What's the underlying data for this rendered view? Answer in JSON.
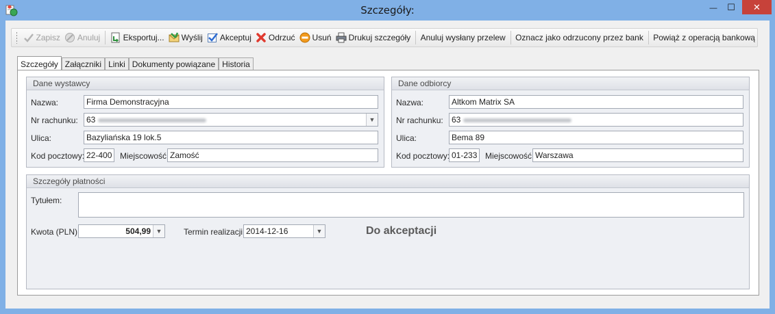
{
  "window": {
    "title": "Szczegóły:",
    "minimize": "—",
    "maximize": "☐",
    "close": "✕"
  },
  "toolbar": {
    "save": "Zapisz",
    "cancel": "Anuluj",
    "export": "Eksportuj...",
    "send": "Wyślij",
    "accept": "Akceptuj",
    "reject": "Odrzuć",
    "delete": "Usuń",
    "print": "Drukuj szczegóły",
    "cancel_sent": "Anuluj wysłany przelew",
    "mark_rejected": "Oznacz jako odrzucony przez bank",
    "link_bank": "Powiąż z operacją bankową"
  },
  "tabs": [
    "Szczegóły",
    "Załączniki",
    "Linki",
    "Dokumenty powiązane",
    "Historia"
  ],
  "issuer": {
    "header": "Dane wystawcy",
    "name_label": "Nazwa:",
    "name": "Firma Demonstracyjna",
    "account_label": "Nr rachunku:",
    "account_prefix": "63",
    "street_label": "Ulica:",
    "street": "Bazyliańska 19 lok.5",
    "postcode_label": "Kod pocztowy:",
    "postcode": "22-400",
    "city_label": "Miejscowość:",
    "city": "Zamość"
  },
  "recipient": {
    "header": "Dane odbiorcy",
    "name_label": "Nazwa:",
    "name": "Altkom Matrix SA",
    "account_label": "Nr rachunku:",
    "account_prefix": "63",
    "street_label": "Ulica:",
    "street": "Bema 89",
    "postcode_label": "Kod pocztowy:",
    "postcode": "01-233",
    "city_label": "Miejscowość:",
    "city": "Warszawa"
  },
  "payment": {
    "header": "Szczegóły płatności",
    "title_label": "Tytułem:",
    "title": "",
    "amount_label": "Kwota (PLN):",
    "amount": "504,99",
    "date_label": "Termin realizacji:",
    "date": "2014-12-16",
    "status": "Do akceptacji"
  }
}
